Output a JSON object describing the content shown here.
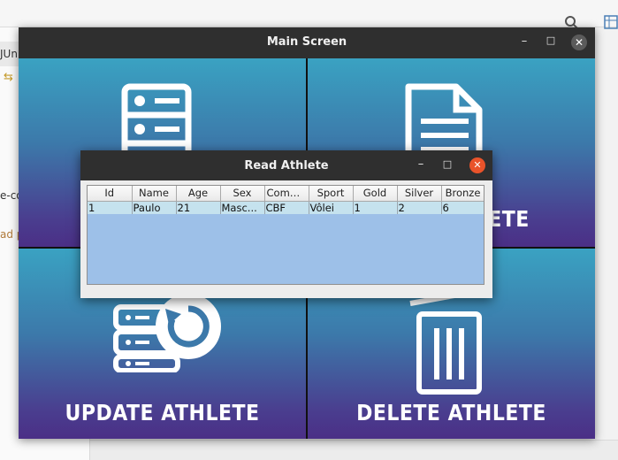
{
  "background": {
    "tab_text": "JUni",
    "side_text_1": "e-co",
    "side_text_2": "ad p"
  },
  "main_window": {
    "title": "Main Screen",
    "minimize": "–",
    "maximize": "□",
    "close": "✕",
    "tiles": [
      {
        "label": "",
        "icon": "database-server-icon"
      },
      {
        "label": "ETE",
        "icon": "document-icon"
      },
      {
        "label": "UPDATE ATHLETE",
        "icon": "server-refresh-icon"
      },
      {
        "label": "DELETE ATHLETE",
        "icon": "trash-icon"
      }
    ]
  },
  "dialog": {
    "title": "Read Athlete",
    "minimize": "–",
    "maximize": "□",
    "close": "✕",
    "columns": [
      "Id",
      "Name",
      "Age",
      "Sex",
      "Comm...",
      "Sport",
      "Gold",
      "Silver",
      "Bronze"
    ],
    "rows": [
      [
        "1",
        "Paulo",
        "21",
        "Masc...",
        "CBF",
        "Vôlei",
        "1",
        "2",
        "6"
      ]
    ]
  },
  "colors": {
    "tile_top": "#3aa2c2",
    "tile_bottom": "#4b2f86",
    "close_active": "#e9532a",
    "table_bg": "#9dc0e8"
  }
}
